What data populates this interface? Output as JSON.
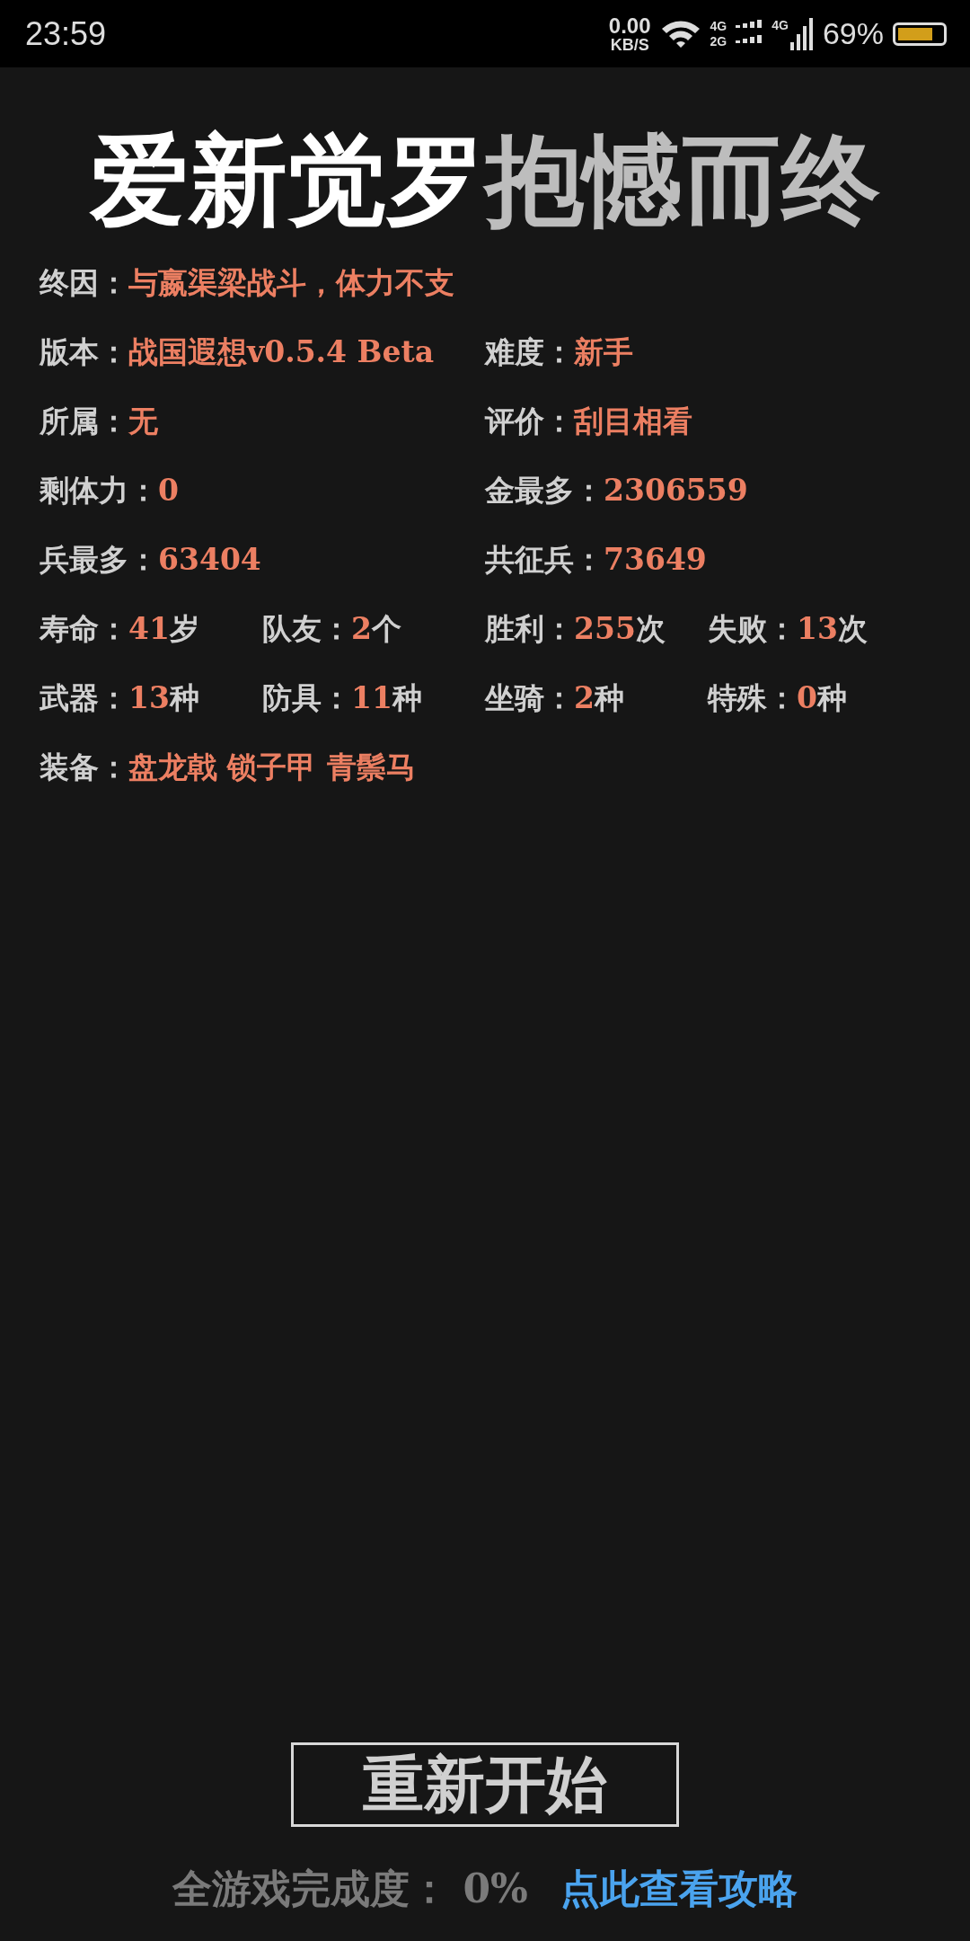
{
  "status_bar": {
    "time": "23:59",
    "net_speed": "0.00",
    "net_unit": "KB/S",
    "sim1_top": "4G",
    "sim1_bottom": "2G",
    "sim2": "4G",
    "battery": "69%"
  },
  "title": {
    "name": "爱新觉罗",
    "result": "抱憾而终"
  },
  "rows": [
    [
      [
        {
          "label": "终因：",
          "value": "与嬴渠梁战斗，体力不支"
        }
      ]
    ],
    [
      [
        {
          "label": "版本：",
          "value": "战国遐想v0.5.4 Beta"
        }
      ],
      [
        {
          "label": "难度：",
          "value": "新手"
        }
      ]
    ],
    [
      [
        {
          "label": "所属：",
          "value": "无"
        }
      ],
      [
        {
          "label": "评价：",
          "value": "刮目相看"
        }
      ]
    ],
    [
      [
        {
          "label": "剩体力：",
          "value": "0"
        }
      ],
      [
        {
          "label": "金最多：",
          "value": "2306559"
        }
      ]
    ],
    [
      [
        {
          "label": "兵最多：",
          "value": "63404"
        }
      ],
      [
        {
          "label": "共征兵：",
          "value": "73649"
        }
      ]
    ],
    [
      [
        {
          "label": "寿命：",
          "value": "41",
          "unit": "岁"
        },
        {
          "label": "队友：",
          "value": "2",
          "unit": "个"
        }
      ],
      [
        {
          "label": "胜利：",
          "value": "255",
          "unit": "次"
        },
        {
          "label": "失败：",
          "value": "13",
          "unit": "次"
        }
      ]
    ],
    [
      [
        {
          "label": "武器：",
          "value": "13",
          "unit": "种"
        },
        {
          "label": "防具：",
          "value": "11",
          "unit": "种"
        }
      ],
      [
        {
          "label": "坐骑：",
          "value": "2",
          "unit": "种"
        },
        {
          "label": "特殊：",
          "value": "0",
          "unit": "种"
        }
      ]
    ],
    [
      [
        {
          "label": "装备：",
          "value": "盘龙戟 锁子甲 青鬃马"
        }
      ]
    ]
  ],
  "restart_button": "重新开始",
  "completion": "全游戏完成度： 0%",
  "guide_link": "点此查看攻略"
}
